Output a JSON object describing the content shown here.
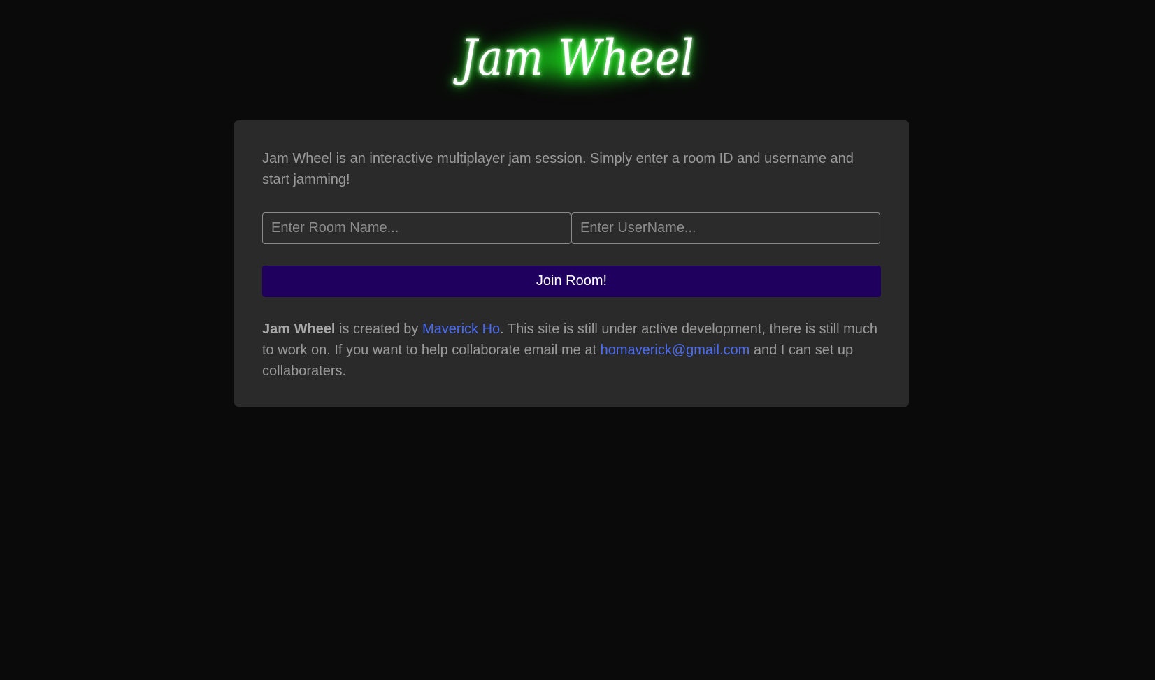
{
  "header": {
    "logo_text": "Jam Wheel"
  },
  "card": {
    "intro": "Jam Wheel is an interactive multiplayer jam session. Simply enter a room ID and username and start jamming!",
    "room_input": {
      "placeholder": "Enter Room Name...",
      "value": ""
    },
    "username_input": {
      "placeholder": "Enter UserName...",
      "value": ""
    },
    "join_button_label": "Join Room!",
    "footer": {
      "brand": "Jam Wheel",
      "text_1": " is created by ",
      "author_link": "Maverick Ho",
      "text_2": ". This site is still under active development, there is still much to work on. If you want to help collaborate email me at ",
      "email_link": "homaverick@gmail.com",
      "text_3": " and I can set up collaboraters."
    }
  },
  "colors": {
    "background": "#0a0a0a",
    "card": "#2a2a2a",
    "button": "#20005e",
    "link": "#4b6cf0",
    "glow": "#22dc22"
  }
}
